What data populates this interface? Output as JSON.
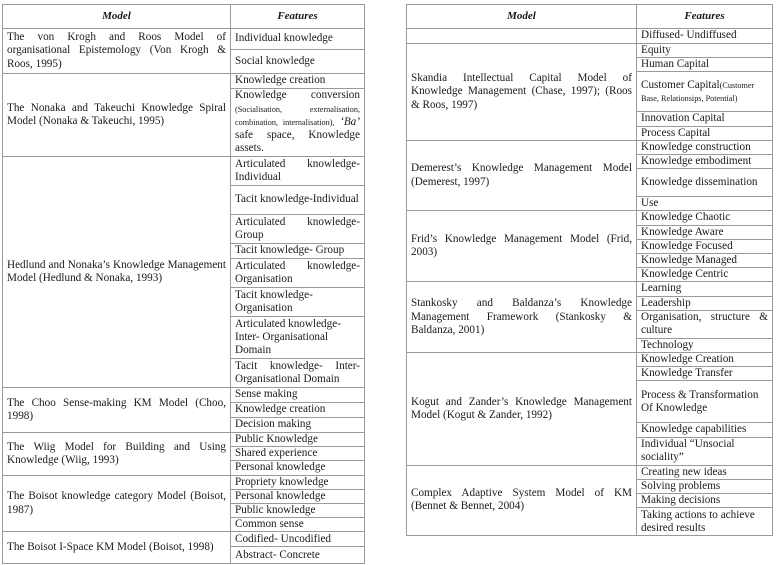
{
  "left_table": {
    "headers": [
      "Model",
      "Features"
    ],
    "groups": [
      {
        "model": "The von Krogh and Roos Model of organisational Epistemology (Von Krogh & Roos, 1995)",
        "features": [
          "Individual knowledge",
          "Social knowledge"
        ]
      },
      {
        "model": "The Nonaka and Takeuchi Knowledge Spiral Model (Nonaka & Takeuchi, 1995)",
        "features": [
          "Knowledge creation",
          "Knowledge conversion",
          "(Socialisation, externalisation, combination, internalisation),",
          "‘Ba’",
          "safe space, Knowledge assets."
        ]
      },
      {
        "model": "Hedlund and Nonaka’s Knowledge Management Model (Hedlund & Nonaka, 1993)",
        "features": [
          "Articulated knowledge-Individual",
          "Tacit knowledge-Individual",
          "Articulated knowledge-Group",
          "Tacit knowledge- Group",
          "Articulated knowledge-Organisation",
          "Tacit knowledge-Organisation",
          "Articulated knowledge-Inter- Organisational Domain",
          "Tacit knowledge- Inter-Organisational Domain"
        ]
      },
      {
        "model": "The Choo Sense-making KM Model (Choo, 1998)",
        "features": [
          "Sense making",
          "Knowledge creation",
          "Decision making"
        ]
      },
      {
        "model": "The Wiig Model for Building and Using Knowledge (Wiig, 1993)",
        "features": [
          "Public Knowledge",
          "Shared experience",
          "Personal knowledge"
        ]
      },
      {
        "model": "The Boisot knowledge category Model (Boisot, 1987)",
        "features": [
          "Propriety knowledge",
          "Personal knowledge",
          "Public knowledge",
          "Common sense"
        ]
      },
      {
        "model": "The Boisot I-Space KM Model (Boisot, 1998)",
        "features": [
          "Codified- Uncodified",
          "Abstract- Concrete"
        ]
      }
    ]
  },
  "right_table": {
    "headers": [
      "Model",
      "Features"
    ],
    "groups": [
      {
        "model": "",
        "features": [
          "Diffused- Undiffused"
        ]
      },
      {
        "model": "Skandia Intellectual Capital Model of Knowledge Management (Chase, 1997); (Roos & Roos, 1997)",
        "features": [
          "Equity",
          "Human Capital",
          "Customer Capital",
          "(Customer Base, Relationsips, Potential)",
          "Innovation Capital",
          "Process Capital"
        ]
      },
      {
        "model": "Demerest’s Knowledge Management Model (Demerest, 1997)",
        "features": [
          "Knowledge construction",
          "Knowledge embodiment",
          "Knowledge dissemination",
          "Use"
        ]
      },
      {
        "model": "Frid’s Knowledge Management Model (Frid, 2003)",
        "features": [
          "Knowledge Chaotic",
          "Knowledge Aware",
          "Knowledge Focused",
          "Knowledge Managed",
          "Knowledge Centric"
        ]
      },
      {
        "model": "Stankosky and Baldanza’s Knowledge Management Framework (Stankosky & Baldanza, 2001)",
        "features": [
          "Learning",
          "Leadership",
          "Organisation, structure & culture",
          "Technology"
        ]
      },
      {
        "model": "Kogut and Zander’s Knowledge Management Model (Kogut & Zander, 1992)",
        "features": [
          "Knowledge Creation",
          "Knowledge Transfer",
          "Process & Transformation Of Knowledge",
          "Knowledge capabilities",
          "Individual “Unsocial sociality”"
        ]
      },
      {
        "model": "Complex Adaptive System Model of KM (Bennet & Bennet, 2004)",
        "features": [
          "Creating new ideas",
          "Solving problems",
          "Making decisions",
          "Taking actions to achieve desired results"
        ]
      }
    ]
  }
}
